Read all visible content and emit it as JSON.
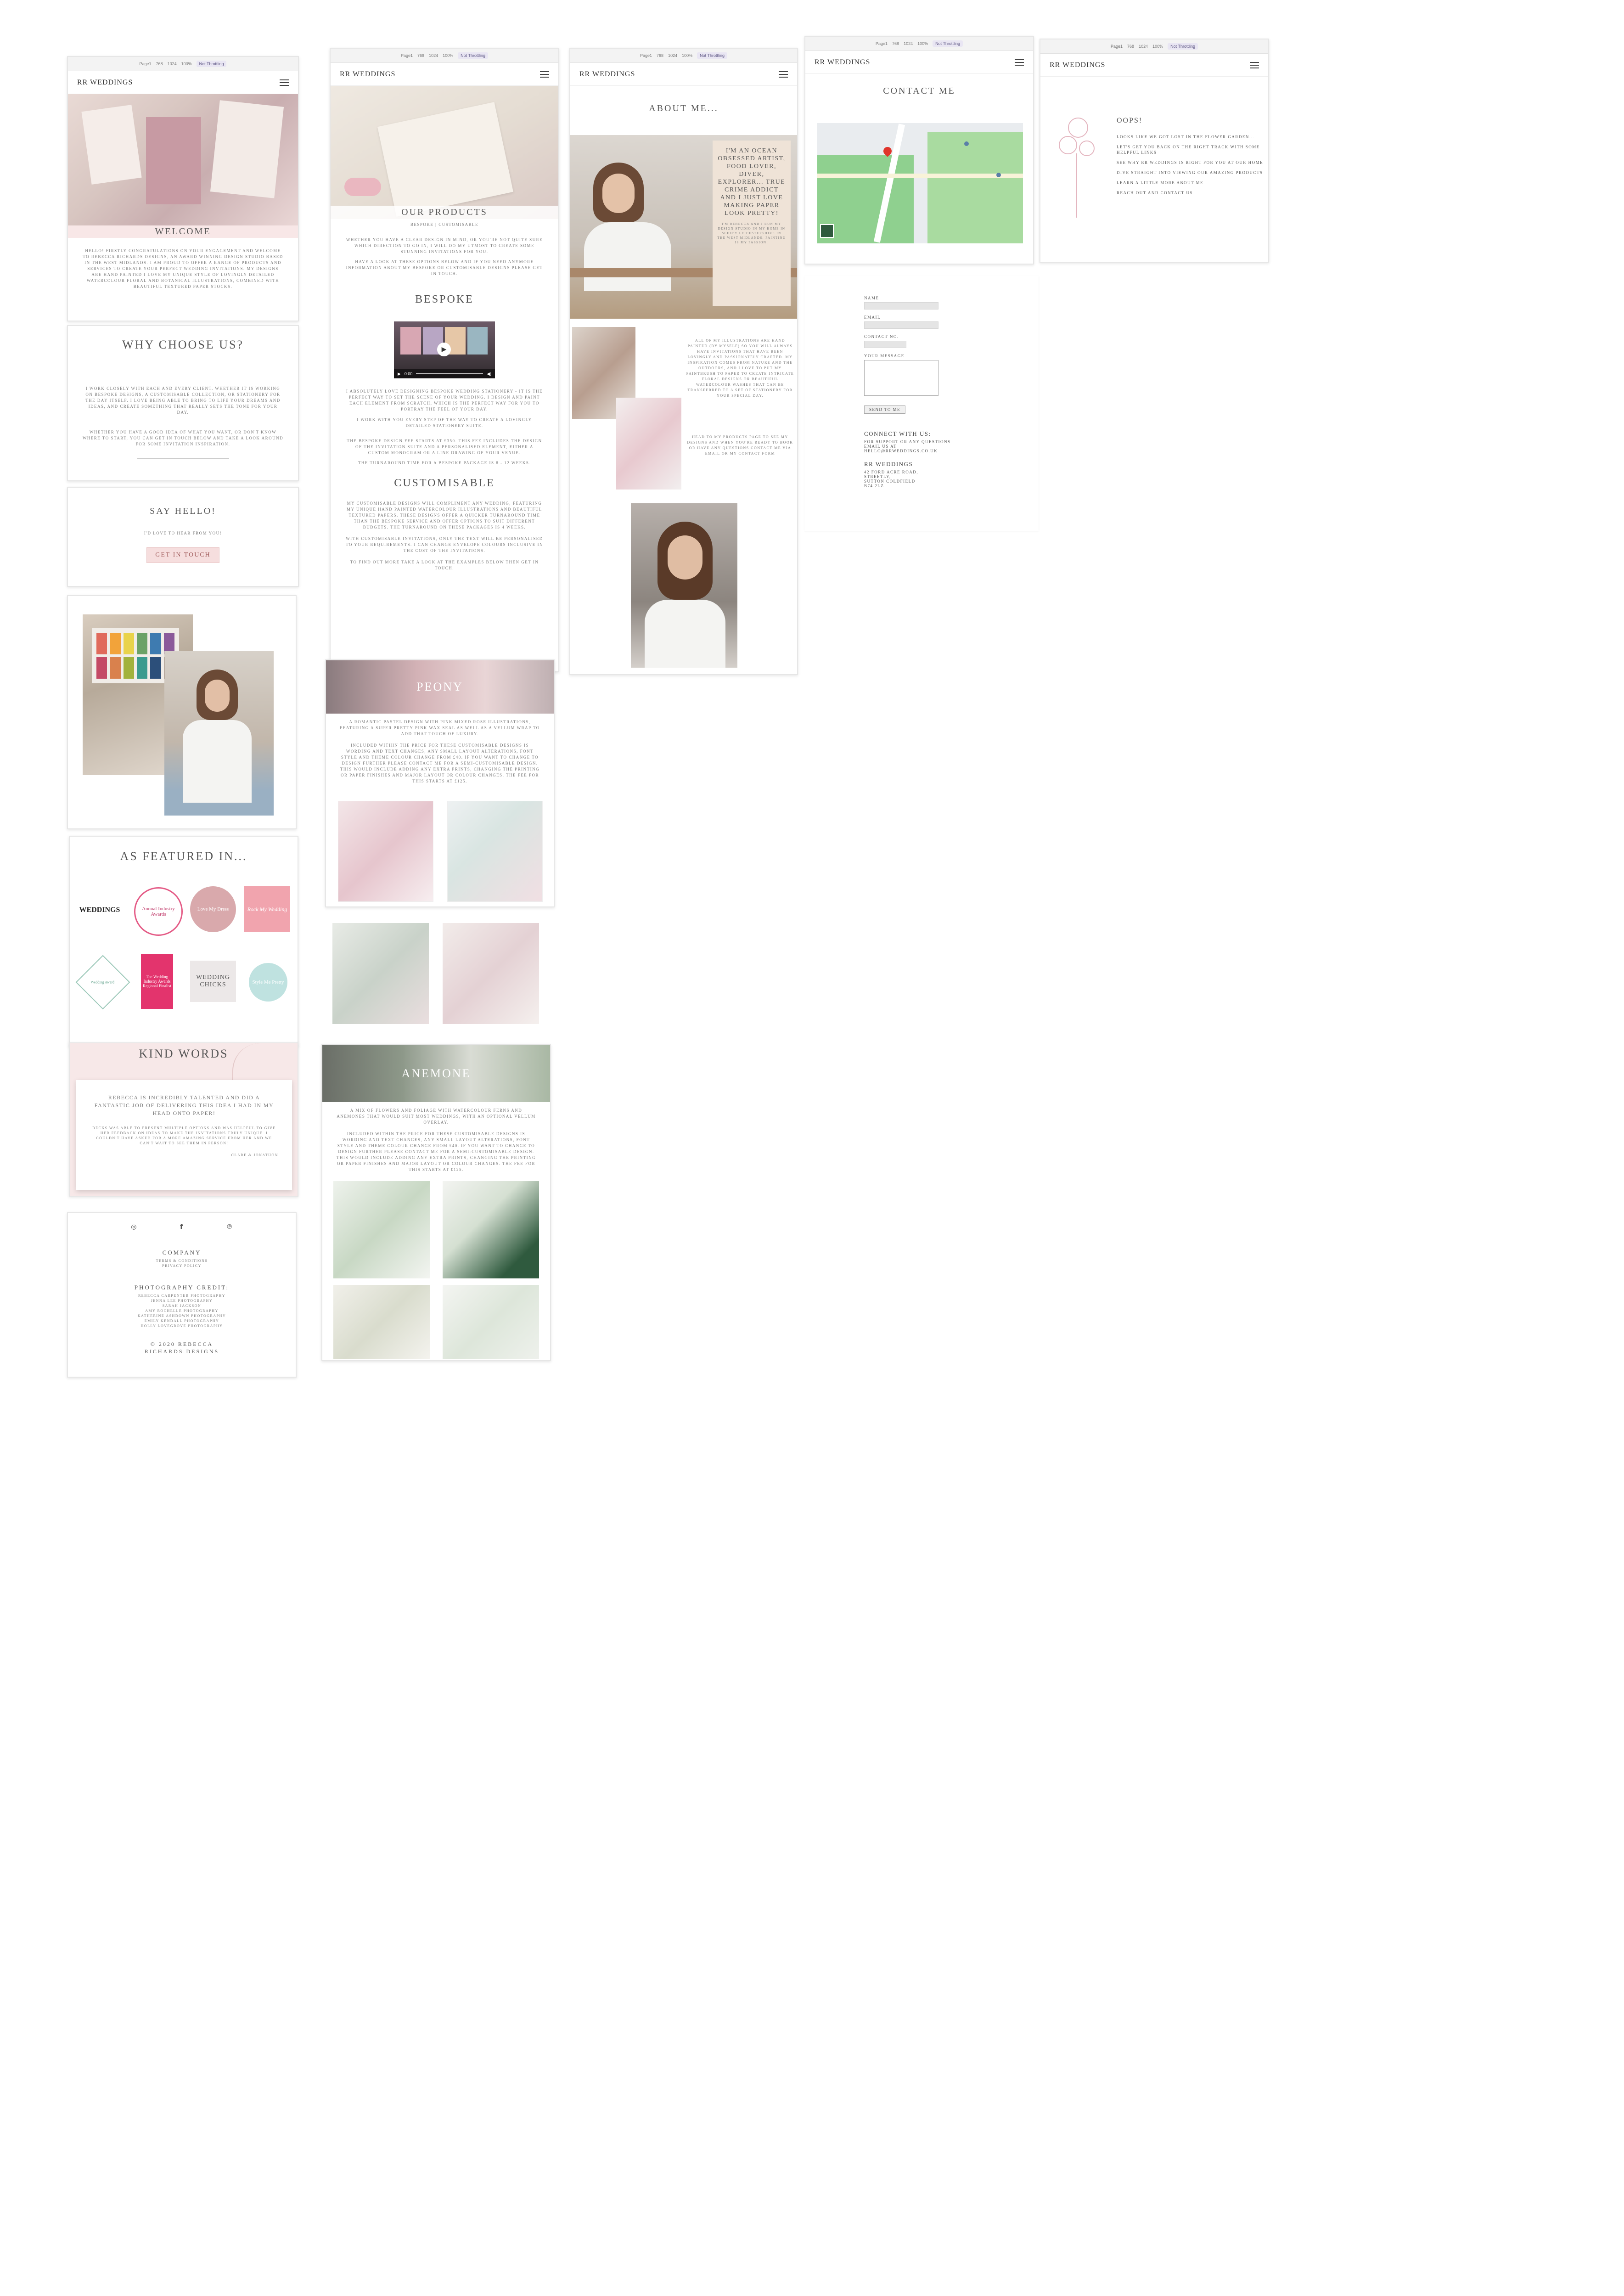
{
  "browser": {
    "url_parts": [
      "Page1",
      "768",
      "1024",
      "100%"
    ],
    "device_label": "Not Throttling"
  },
  "brand": "RR WEDDINGS",
  "home": {
    "welcome_title": "WELCOME",
    "welcome_text": "Hello! Firstly congratulations on your engagement and welcome to Rebecca Richards Designs, an award winning design studio based in the West Midlands. I am proud to offer a range of products and services to create your perfect wedding invitations. My designs are hand painted I love my unique style of lovingly detailed watercolour floral and botanical illustrations, combined with beautiful textured paper stocks.",
    "why_title": "WHY CHOOSE US?",
    "why_text_1": "I work closely with each and every client. Whether it is working on bespoke designs, a customisable collection, or stationery for the day itself. I love being able to bring to life your dreams and ideas, and create something that really sets the tone for your day.",
    "why_text_2": "Whether you have a good idea of what you want, or don't know where to start, you can get in touch below and take a look around for some invitation inspiration.",
    "hello_title": "SAY HELLO!",
    "hello_text": "I'd love to hear from you!",
    "get_in_touch": "GET IN TOUCH",
    "featured_title": "AS FEATURED IN...",
    "featured_logos": [
      "WEDDINGS",
      "Annual Industry Awards",
      "Love My Dress",
      "Rock My Wedding",
      "Wedding Award",
      "The Wedding Industry Awards Regional Finalist",
      "WEDDING CHICKS",
      "Style Me Pretty"
    ],
    "kind_words_title": "KIND WORDS",
    "quote_main": "Rebecca is incredibly talented and did a fantastic job of delivering this idea I had in my head onto paper!",
    "quote_body": "Becks was able to present multiple options and was helpful to give her feedback on ideas to make the invitations truly unique. I couldn't have asked for a more amazing service from her and we can't wait to see them in person!",
    "quote_author": "Clare & Jonathon",
    "footer_company_title": "COMPANY",
    "footer_company_links": [
      "Terms & Conditions",
      "Privacy Policy"
    ],
    "footer_photo_title": "PHOTOGRAPHY CREDIT:",
    "footer_photo_credits": [
      "Rebecca Carpenter Photography",
      "Jenna Lee Photography",
      "Sarah Jackson",
      "Amy Rochelle Photography",
      "Katherine Ashdown Photography",
      "Emily Kendall Photography",
      "Holly Lovegrove Photography"
    ],
    "footer_copyright": "© 2020 REBECCA RICHARDS DESIGNS"
  },
  "products": {
    "title": "OUR PRODUCTS",
    "sub_links": "BESPOKE | CUSTOMISABLE",
    "intro_1": "Whether you have a clear design in mind, or you're not quite sure which direction to go in, I will do my utmost to create some stunning invitations for you.",
    "intro_2": "Have a look at these options below and if you need anymore information about my bespoke or customisable designs please get in touch.",
    "bespoke_title": "BESPOKE",
    "video_time": "0:00",
    "bespoke_text_1": "I absolutely love designing bespoke wedding stationery - it is the perfect way to set the scene of your wedding. I design and paint each element from scratch, which is the perfect way for you to portray the feel of your day.",
    "bespoke_text_2": "I work with you every step of the way to create a lovingly detailed stationery suite.",
    "bespoke_text_3": "The bespoke design fee starts at £350. This fee includes the design of the invitation suite and a personalised element, either a custom monogram or a line drawing of your venue.",
    "bespoke_text_4": "The turnaround time for a bespoke package is 8 - 12 weeks.",
    "custom_title": "CUSTOMISABLE",
    "custom_text_1": "My customisable designs will compliment any wedding, featuring my unique hand painted watercolour illustrations and beautiful textured papers. These designs offer a quicker turnaround time than the bespoke service and offer options to suit different budgets. The turnaround on these packages is 4 weeks.",
    "custom_text_2": "With customisable invitations, only the text will be personalised to your requirements. I can change envelope colours inclusive in the cost of the invitations.",
    "custom_text_3": "To find out more take a look at the examples below then get in touch.",
    "peony_title": "PEONY",
    "peony_text_1": "A romantic pastel design with pink mixed rose illustrations, featuring a super pretty pink wax seal as well as a vellum wrap to add that touch of luxury.",
    "peony_text_2": "Included within the price for these customisable designs is wording and text changes, any small layout alterations, font style and theme colour change from £40. If you want to change to design further please contact me for a semi-customisable design. This would include adding any extra prints, changing the printing or paper finishes and major layout or colour changes. The fee for this starts at £125.",
    "anemone_title": "ANEMONE",
    "anemone_text_1": "A mix of flowers and foliage with watercolour ferns and anemones that would suit most weddings, with an optional vellum overlay.",
    "anemone_text_2": "Included within the price for these customisable designs is wording and text changes, any small layout alterations, font style and theme colour change from £40. If you want to change to design further please contact me for a semi-customisable design. This would include adding any extra prints, changing the printing or paper finishes and major layout or colour changes. The fee for this starts at £125."
  },
  "about": {
    "title": "ABOUT ME...",
    "tagline": "I'M AN OCEAN OBSESSED ARTIST, FOOD LOVER, DIVER, EXPLORER... TRUE CRIME ADDICT AND I JUST LOVE MAKING PAPER LOOK PRETTY!",
    "tagline_sub": "I'm Rebecca and I run my design studio in my home in sleepy Leicestershire in the West Midlands. Painting is my passion!",
    "body_1": "All of my illustrations are hand painted (by myself) so you will always have invitations that have been lovingly and passionately crafted. My inspiration comes from nature and the outdoors, and I love to put my paintbrush to paper to create intricate floral designs or beautiful watercolour washes that can be transferred to a set of stationery for your special day.",
    "body_2": "Head to my PRODUCTS page to see my designs and when you're ready to book or have any questions contact me via EMAIL or my CONTACT FORM"
  },
  "contact": {
    "title": "CONTACT ME",
    "form_labels": [
      "NAME",
      "EMAIL",
      "CONTACT NO.",
      "YOUR MESSAGE"
    ],
    "send_button": "SEND TO ME",
    "connect_title": "CONNECT WITH US:",
    "connect_lines": [
      "For support or any questions",
      "Email us at",
      "hello@rrweddings.co.uk"
    ],
    "address_title": "RR WEDDINGS",
    "address_lines": [
      "42 Ford Acre Road,",
      "Streetly,",
      "Sutton Coldfield",
      "B74 2LZ"
    ]
  },
  "error": {
    "title": "OOPS!",
    "line_1": "Looks like we got lost in the flower garden...",
    "line_2": "Let's get you back on the right track with some helpful links",
    "line_3": "See why RR Weddings is right for you at our HOME",
    "line_4": "Dive straight into viewing our amazing PRODUCTS",
    "line_5": "Learn a little more ABOUT ME",
    "line_6": "Reach out and CONTACT US"
  },
  "colors": {
    "accent_pink": "#f4dcdc",
    "map_green": "#8fd08f",
    "forest_green": "#2f5a3e"
  }
}
